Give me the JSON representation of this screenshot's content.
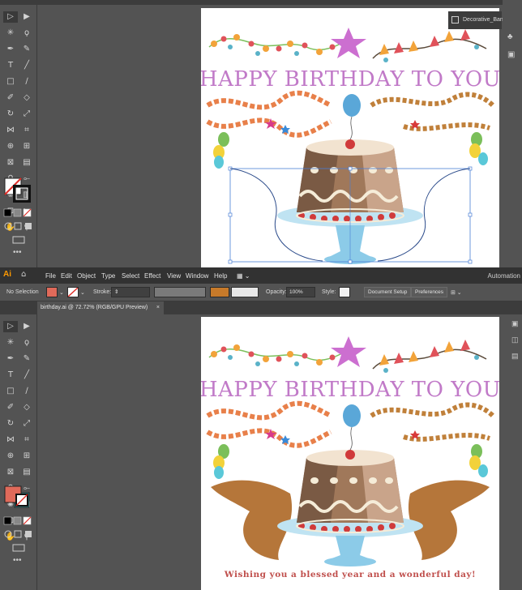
{
  "top_panel": {
    "floating_panel_label": "Decorative_Ban..."
  },
  "artwork": {
    "headline": "HAPPY BIRTHDAY TO YOU",
    "caption": "Wishing you a blessed year and a wonderful day!"
  },
  "menubar": {
    "app_logo": "Ai",
    "items": [
      "File",
      "Edit",
      "Object",
      "Type",
      "Select",
      "Effect",
      "View",
      "Window",
      "Help"
    ],
    "workspace": "Automation"
  },
  "control_bar": {
    "selection_status": "No Selection",
    "stroke_label": "Stroke:",
    "opacity_label": "Opacity:",
    "opacity_value": "100%",
    "style_label": "Style:",
    "document_setup": "Document Setup",
    "preferences": "Preferences"
  },
  "document_tab": {
    "title": "birthday.ai @ 72.72% (RGB/GPU Preview)",
    "close": "×"
  },
  "colors": {
    "app_bg": "#535353",
    "menubar_bg": "#323232",
    "fill_swatch": "#e06a5a",
    "stroke_swatch": "#3aa9b0",
    "brand": "#ff9a00",
    "selection_blue": "#4a7fd6"
  }
}
